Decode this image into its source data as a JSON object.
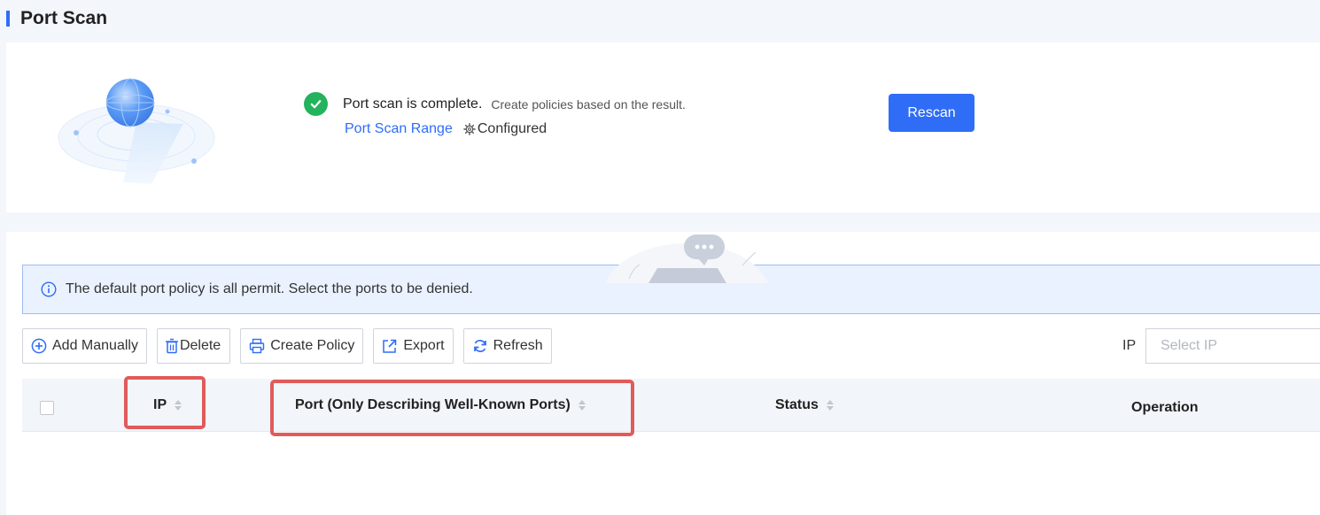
{
  "page": {
    "title": "Port Scan"
  },
  "scan": {
    "status_title": "Port scan is complete.",
    "status_hint": "Create policies based on the result.",
    "range_link": "Port Scan Range",
    "range_state": "Configured",
    "rescan_label": "Rescan"
  },
  "banner": {
    "text": "The default port policy is all permit. Select the ports to be denied."
  },
  "toolbar": {
    "add_manually": "Add Manually",
    "delete": "Delete",
    "create_policy": "Create Policy",
    "export": "Export",
    "refresh": "Refresh"
  },
  "filter": {
    "label": "IP",
    "placeholder": "Select IP"
  },
  "table": {
    "columns": [
      {
        "label": "IP",
        "sortable": true
      },
      {
        "label": "Port (Only Describing Well-Known Ports)",
        "sortable": true
      },
      {
        "label": "Status",
        "sortable": true
      },
      {
        "label": "Operation",
        "sortable": false
      }
    ]
  },
  "colors": {
    "accent": "#2f6df6",
    "success": "#23b35c",
    "highlight": "#e05b5b",
    "banner_bg": "#eaf2ff"
  }
}
